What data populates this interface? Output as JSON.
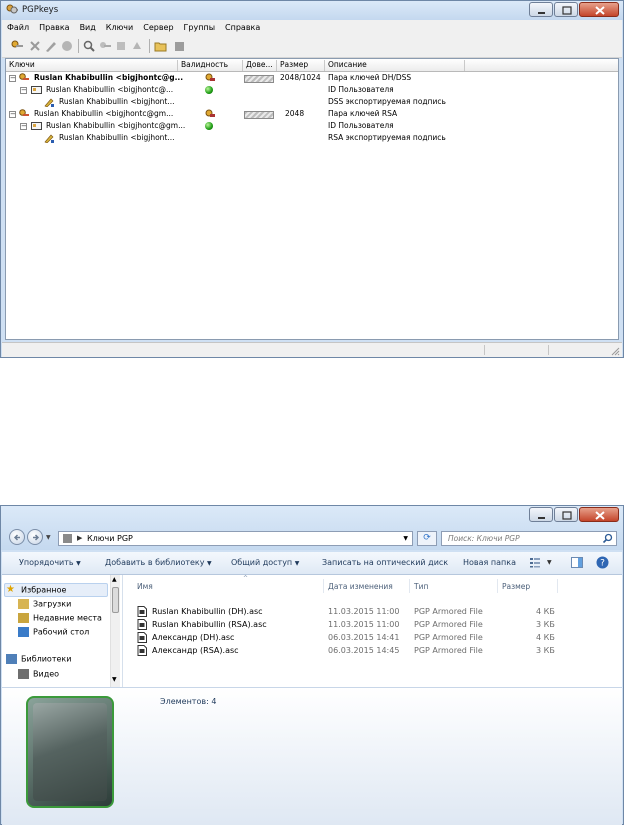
{
  "pgp": {
    "title": "PGPkeys",
    "menu": [
      "Файл",
      "Правка",
      "Вид",
      "Ключи",
      "Сервер",
      "Группы",
      "Справка"
    ],
    "columns": [
      "Ключи",
      "Валидность",
      "Дове...",
      "Размер",
      "Описание"
    ],
    "rows": [
      {
        "name": "Ruslan Khabibullin <bigjhontc@g...",
        "size": "2048/1024",
        "desc": "Пара ключей DH/DSS"
      },
      {
        "name": "Ruslan Khabibullin <bigjhontc@...",
        "size": "",
        "desc": "ID Пользователя"
      },
      {
        "name": "Ruslan Khabibullin <bigjhont...",
        "size": "",
        "desc": "DSS экспортируемая подпись"
      },
      {
        "name": "Ruslan Khabibullin <bigjhontc@gm...",
        "size": "2048",
        "desc": "Пара ключей RSA"
      },
      {
        "name": "Ruslan Khabibullin <bigjhontc@gm...",
        "size": "",
        "desc": "ID Пользователя"
      },
      {
        "name": "Ruslan Khabibullin <bigjhont...",
        "size": "",
        "desc": "RSA экспортируемая подпись"
      }
    ]
  },
  "explorer": {
    "path": "Ключи PGP",
    "search_placeholder": "Поиск: Ключи PGP",
    "commands": {
      "organize": "Упорядочить",
      "add_library": "Добавить в библиотеку",
      "share": "Общий доступ",
      "burn": "Записать на оптический диск",
      "new_folder": "Новая папка"
    },
    "nav": {
      "favorites": "Избранное",
      "downloads": "Загрузки",
      "recent": "Недавние места",
      "desktop": "Рабочий стол",
      "libraries": "Библиотеки",
      "video": "Видео"
    },
    "columns": {
      "name": "Имя",
      "date": "Дата изменения",
      "type": "Тип",
      "size": "Размер"
    },
    "files": [
      {
        "name": "Ruslan Khabibullin (DH).asc",
        "date": "11.03.2015 11:00",
        "type": "PGP Armored File",
        "size": "4 КБ"
      },
      {
        "name": "Ruslan Khabibullin (RSA).asc",
        "date": "11.03.2015 11:00",
        "type": "PGP Armored File",
        "size": "3 КБ"
      },
      {
        "name": "Александр (DH).asc",
        "date": "06.03.2015 14:41",
        "type": "PGP Armored File",
        "size": "4 КБ"
      },
      {
        "name": "Александр (RSA).asc",
        "date": "06.03.2015 14:45",
        "type": "PGP Armored File",
        "size": "3 КБ"
      }
    ],
    "details": "Элементов: 4"
  }
}
